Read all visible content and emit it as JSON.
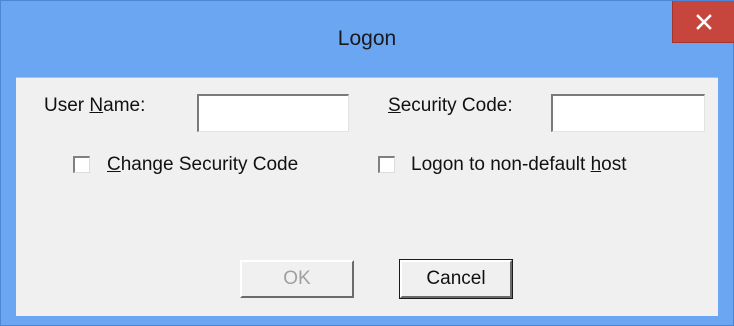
{
  "window": {
    "title": "Logon",
    "close_glyph": "✕"
  },
  "form": {
    "user_name": {
      "label_prefix": "User ",
      "label_mnemonic": "N",
      "label_suffix": "ame:",
      "value": ""
    },
    "security_code": {
      "label_prefix": "",
      "label_mnemonic": "S",
      "label_suffix": "ecurity Code:",
      "value": ""
    },
    "change_security_code": {
      "label_prefix": "",
      "label_mnemonic": "C",
      "label_suffix": "hange Security Code",
      "checked": false
    },
    "non_default_host": {
      "label_prefix": "Logon to non-default ",
      "label_mnemonic": "h",
      "label_suffix": "ost",
      "checked": false
    }
  },
  "buttons": {
    "ok_label": "OK",
    "ok_enabled": false,
    "cancel_label": "Cancel"
  },
  "colors": {
    "title_bar": "#6aa6f2",
    "close_button": "#c6463d",
    "dialog_face": "#f0f0f0"
  },
  "icons": {
    "close": "close-icon"
  }
}
